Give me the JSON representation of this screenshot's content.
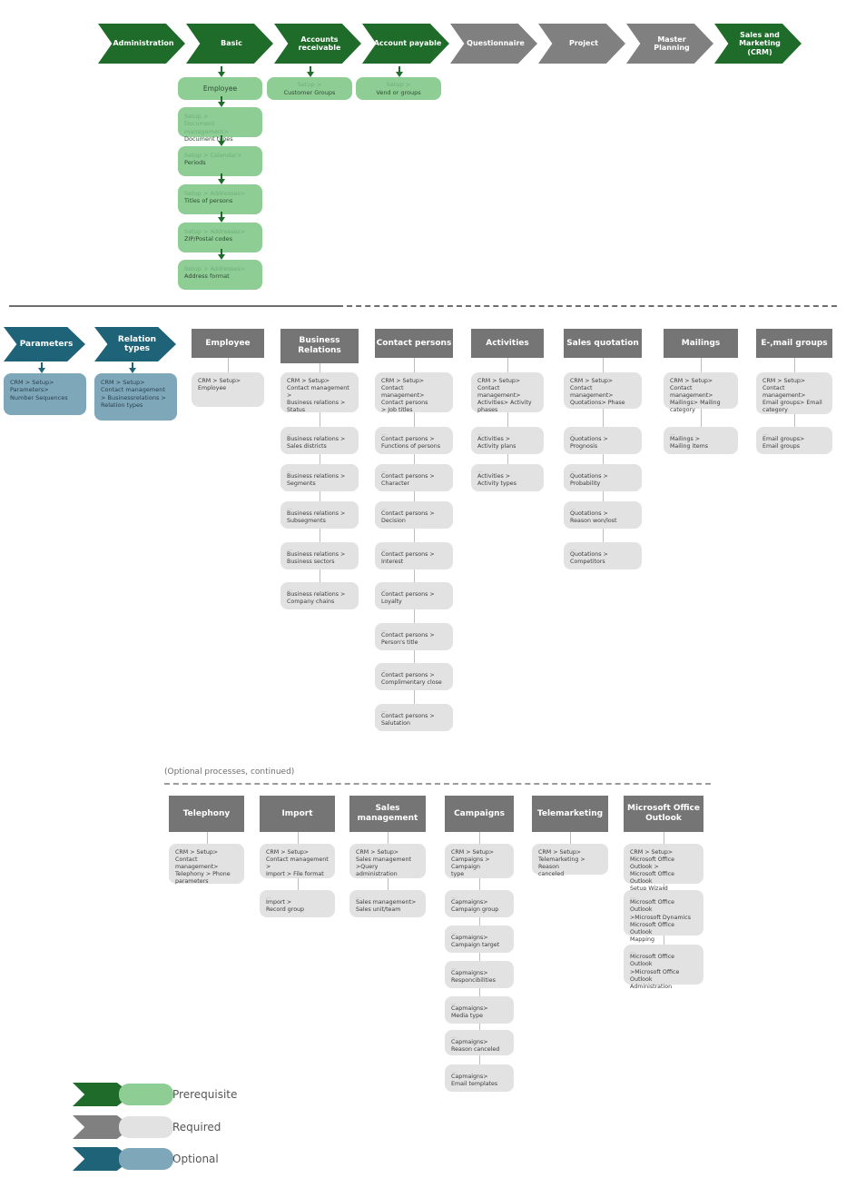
{
  "colors": {
    "prerequisite_dark": "#1e6b2a",
    "prerequisite_light": "#8ece95",
    "required_dark": "#808080",
    "required_light": "#e2e2e2",
    "optional_dark": "#1f6379",
    "optional_light": "#7fa7ba"
  },
  "top_flow": {
    "chevrons": [
      {
        "label": "Administration",
        "type": "prerequisite"
      },
      {
        "label": "Basic",
        "type": "prerequisite"
      },
      {
        "label": "Accounts\nreceivable",
        "type": "prerequisite"
      },
      {
        "label": "Account payable",
        "type": "prerequisite"
      },
      {
        "label": "Questionnaire",
        "type": "required"
      },
      {
        "label": "Project",
        "type": "required"
      },
      {
        "label": "Master\nPlanning",
        "type": "required"
      },
      {
        "label": "Sales and\nMarketing\n(CRM)",
        "type": "prerequisite"
      }
    ],
    "basic_chain": [
      {
        "pre": "",
        "main": "Employee"
      },
      {
        "pre": "Setup >\nDocument management>",
        "main": "Document types"
      },
      {
        "pre": "Setup > Calendar>",
        "main": "Periods"
      },
      {
        "pre": "Setup > Addresses>",
        "main": "Titles of persons"
      },
      {
        "pre": "Setup > Addresses>",
        "main": "ZIP/Postal codes"
      },
      {
        "pre": "Setup > Addresses>",
        "main": "Address format"
      }
    ],
    "accounts_receivable_box": {
      "pre": "Setup >",
      "main": "Customer Groups"
    },
    "account_payable_box": {
      "pre": "Setup >",
      "main": "Vend or groups"
    }
  },
  "section_two": {
    "chevrons": [
      {
        "label": "Parameters",
        "type": "optional"
      },
      {
        "label": "Relation\ntypes",
        "type": "optional"
      }
    ],
    "chevron_boxes": [
      {
        "pre": "",
        "main": "CRM > Setup>\nParameters>\nNumber Sequences"
      },
      {
        "pre": "",
        "main": "CRM > Setup>\nContact management\n> Businessrelations >\nRelation types"
      }
    ],
    "columns": [
      {
        "title": "Employee",
        "items": [
          {
            "pre": "",
            "main": "CRM > Setup>\nEmployee"
          }
        ]
      },
      {
        "title": "Business\nRelations",
        "items": [
          {
            "pre": "",
            "main": "CRM > Setup>\nContact management >\nBusiness relations >\nStatus"
          },
          {
            "pre": "...",
            "main": "Business relations >\nSales districts"
          },
          {
            "pre": "...",
            "main": "Business relations >\nSegments"
          },
          {
            "pre": "...",
            "main": "Business relations >\nSubsegments"
          },
          {
            "pre": "...",
            "main": "Business relations >\nBusiness sectors"
          },
          {
            "pre": "...",
            "main": "Business relations >\nCompany chains"
          }
        ]
      },
      {
        "title": "Contact persons",
        "items": [
          {
            "pre": "",
            "main": "CRM > Setup>\nContact management>\nContact persons\n> Job titles"
          },
          {
            "pre": "...",
            "main": "Contact persons >\nFunctions of persons"
          },
          {
            "pre": "...",
            "main": "Contact persons >\nCharacter"
          },
          {
            "pre": "...",
            "main": "Contact persons >\nDecision"
          },
          {
            "pre": "...",
            "main": "Contact persons >\nInterest"
          },
          {
            "pre": "...",
            "main": "Contact persons >\nLoyalty"
          },
          {
            "pre": "...",
            "main": "Contact persons >\nPerson's title"
          },
          {
            "pre": "...",
            "main": "Contact persons >\nComplimentary close"
          },
          {
            "pre": "...",
            "main": "Contact persons >\nSalutation"
          }
        ]
      },
      {
        "title": "Activities",
        "items": [
          {
            "pre": "",
            "main": "CRM > Setup>\nContact management>\nActivities> Activity phases"
          },
          {
            "pre": "...",
            "main": "Activities >\nActivity plans"
          },
          {
            "pre": "...",
            "main": "Activities >\nActivity types"
          }
        ]
      },
      {
        "title": "Sales quotation",
        "items": [
          {
            "pre": "",
            "main": "CRM > Setup>\nContact management>\nQuotations> Phase"
          },
          {
            "pre": "...",
            "main": "Quotations >\nPrognosis"
          },
          {
            "pre": "...",
            "main": "Quotations >\nProbability"
          },
          {
            "pre": "...",
            "main": "Quotations >\nReason won/lost"
          },
          {
            "pre": "...",
            "main": "Quotations >\nCompetitors"
          }
        ]
      },
      {
        "title": "Mailings",
        "items": [
          {
            "pre": "",
            "main": "CRM > Setup>\nContact management>\nMailings> Mailing category"
          },
          {
            "pre": "...",
            "main": "Mailings >\nMailing items"
          }
        ]
      },
      {
        "title": "E-,mail groups",
        "items": [
          {
            "pre": "",
            "main": "CRM > Setup>\nContact management>\nEmail groups> Email\ncategory"
          },
          {
            "pre": "...",
            "main": "Email groups>\nEmail groups"
          }
        ]
      }
    ]
  },
  "section_three": {
    "caption": "(Optional processes, continued)",
    "columns": [
      {
        "title": "Telephony",
        "items": [
          {
            "pre": "",
            "main": "CRM > Setup>\nContact management>\nTelephony > Phone\nparameters"
          }
        ]
      },
      {
        "title": "Import",
        "items": [
          {
            "pre": "",
            "main": "CRM > Setup>\nContact management >\nImport > File format"
          },
          {
            "pre": "...",
            "main": "Import >\nRecord group"
          }
        ]
      },
      {
        "title": "Sales\nmanagement",
        "items": [
          {
            "pre": "",
            "main": "CRM > Setup>\nSales management\n>Query administration"
          },
          {
            "pre": "...",
            "main": "Sales management>\nSales unit/team"
          }
        ]
      },
      {
        "title": "Campaigns",
        "items": [
          {
            "pre": "",
            "main": "CRM > Setup>\nCampaigns > Campaign\ntype"
          },
          {
            "pre": "...",
            "main": "Capmaigns>\nCampaign group"
          },
          {
            "pre": "...",
            "main": "Capmaigns>\nCampaign target"
          },
          {
            "pre": "...",
            "main": "Capmaigns>\nResponcibilities"
          },
          {
            "pre": "...",
            "main": "Capmaigns>\nMedia type"
          },
          {
            "pre": "...",
            "main": "Capmaigns>\nReason canceled"
          },
          {
            "pre": "...",
            "main": "Capmaigns>\nEmail templates"
          }
        ]
      },
      {
        "title": "Telemarketing",
        "items": [
          {
            "pre": "",
            "main": "CRM > Setup>\nTelemarketing > Reason\ncanceled"
          }
        ]
      },
      {
        "title": "Microsoft Office\nOutlook",
        "items": [
          {
            "pre": "",
            "main": "CRM > Setup>\nMicrosoft Office Outlook >\nMicrosoft Office Outlook\nSetup Wizard"
          },
          {
            "pre": "...",
            "main": "Microsoft Office Outlook\n>Microsoft Dynamics\nMicrosoft Office Outlook\nMapping"
          },
          {
            "pre": "...",
            "main": "Microsoft Office Outlook\n>Microsoft Office Outlook\nAdministration"
          }
        ]
      }
    ]
  },
  "legend": [
    {
      "label": "Prerequisite",
      "dark": "#1e6b2a",
      "light": "#8ece95"
    },
    {
      "label": "Required",
      "dark": "#808080",
      "light": "#e2e2e2"
    },
    {
      "label": "Optional",
      "dark": "#1f6379",
      "light": "#7fa7ba"
    }
  ]
}
